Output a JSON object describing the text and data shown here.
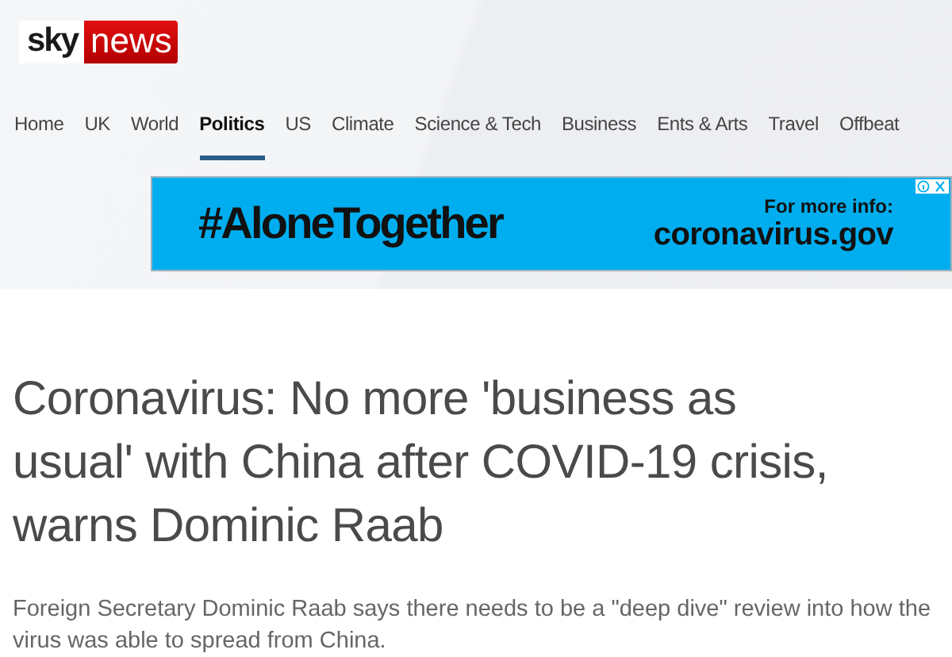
{
  "logo": {
    "part_1": "sky",
    "part_2": "news"
  },
  "nav": [
    {
      "label": "Home",
      "selected": false
    },
    {
      "label": "UK",
      "selected": false
    },
    {
      "label": "World",
      "selected": false
    },
    {
      "label": "Politics",
      "selected": true
    },
    {
      "label": "US",
      "selected": false
    },
    {
      "label": "Climate",
      "selected": false
    },
    {
      "label": "Science & Tech",
      "selected": false
    },
    {
      "label": "Business",
      "selected": false
    },
    {
      "label": "Ents & Arts",
      "selected": false
    },
    {
      "label": "Travel",
      "selected": false
    },
    {
      "label": "Offbeat",
      "selected": false
    }
  ],
  "ad": {
    "headline": "#AloneTogether",
    "info_label": "For more info:",
    "url": "coronavirus.gov"
  },
  "article": {
    "headline": "Coronavirus: No more 'business as usual' with China after COVID-19 crisis, warns Dominic Raab",
    "summary": "Foreign Secretary Dominic Raab says there needs to be a \"deep dive\" review into how the virus was able to spread from China."
  }
}
